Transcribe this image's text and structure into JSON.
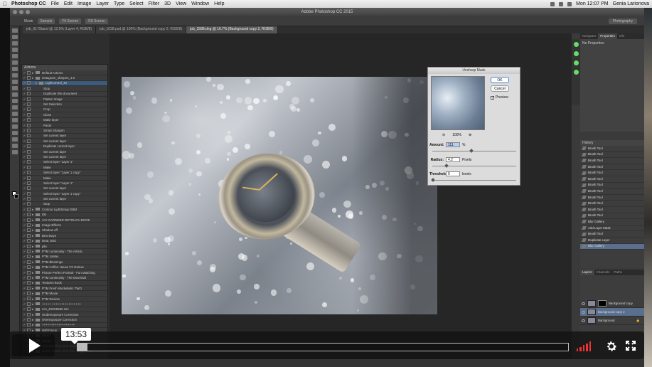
{
  "menubar": {
    "app_name": "Photoshop CC",
    "items": [
      "File",
      "Edit",
      "Image",
      "Layer",
      "Type",
      "Select",
      "Filter",
      "3D",
      "View",
      "Window",
      "Help"
    ],
    "clock": "Mon 12:07 PM",
    "user": "Genia Larionova"
  },
  "titlebar": {
    "title": "Adobe Photoshop CC 2015"
  },
  "optionsbar": {
    "mode_label": "Mode",
    "btn1": "Sample",
    "btn2": "Fit Screen",
    "btn3": "Fill Screen",
    "workspace": "Photography"
  },
  "tabs": [
    "job_917Stand @ 12.5% (Layer 4, RGB/8)",
    "job_1038.psd @ 100% (Background copy 2, RGB/8)",
    "job_1588.dng @ 16.7% (Background copy 2, RGB/8)"
  ],
  "actions_panel": {
    "title": "Actions",
    "rows": [
      {
        "label": "Default Actions",
        "lvl": 0
      },
      {
        "label": "instagram_sharpen_3.0",
        "lvl": 0
      },
      {
        "label": "Lightcontrol_40",
        "lvl": 1
      },
      {
        "label": "Stop",
        "lvl": 2
      },
      {
        "label": "Duplicate first document",
        "lvl": 2
      },
      {
        "label": "Flatten Image",
        "lvl": 2
      },
      {
        "label": "Set Selection",
        "lvl": 2
      },
      {
        "label": "Crop",
        "lvl": 2
      },
      {
        "label": "Close",
        "lvl": 2
      },
      {
        "label": "Make layer",
        "lvl": 2
      },
      {
        "label": "Paste",
        "lvl": 2
      },
      {
        "label": "Smart Sharpen",
        "lvl": 2
      },
      {
        "label": "Set current layer",
        "lvl": 2
      },
      {
        "label": "Set current layer",
        "lvl": 2
      },
      {
        "label": "Duplicate current layer",
        "lvl": 2
      },
      {
        "label": "Set current layer",
        "lvl": 2
      },
      {
        "label": "Set current layer",
        "lvl": 2
      },
      {
        "label": "Select layer \"Layer 1\"",
        "lvl": 2
      },
      {
        "label": "Make",
        "lvl": 2
      },
      {
        "label": "Select layer \"Layer 1 copy\"",
        "lvl": 2
      },
      {
        "label": "Make",
        "lvl": 2
      },
      {
        "label": "Select layer \"Layer 1\"",
        "lvl": 2
      },
      {
        "label": "Set current layer",
        "lvl": 2
      },
      {
        "label": "Select layer \"Layer 1 copy\"",
        "lvl": 2
      },
      {
        "label": "Set current layer",
        "lvl": 2
      },
      {
        "label": "Stop",
        "lvl": 2
      },
      {
        "label": "Contour LightSetup GBM",
        "lvl": 0
      },
      {
        "label": "DB",
        "lvl": 0
      },
      {
        "label": "JAY GARNDER RETOUCH BOOK",
        "lvl": 0
      },
      {
        "label": "Image Effects",
        "lvl": 0
      },
      {
        "label": "Shadow off",
        "lvl": 0
      },
      {
        "label": "Best Days",
        "lvl": 0
      },
      {
        "label": "Dear, Bird",
        "lvl": 0
      },
      {
        "label": "pilo",
        "lvl": 0
      },
      {
        "label": "PTM Luminosity - The Artistic",
        "lvl": 0
      },
      {
        "label": "PTM JoMax",
        "lvl": 0
      },
      {
        "label": "PTM Blessings",
        "lvl": 0
      },
      {
        "label": "PTM Coffee House FX Deluxe",
        "lvl": 0
      },
      {
        "label": "Picture Perfect Portrait - Fun Matching",
        "lvl": 0
      },
      {
        "label": "PTM Luminosity - The Essential",
        "lvl": 0
      },
      {
        "label": "Textures Book",
        "lvl": 0
      },
      {
        "label": "PTM Fresh Workaholic TWO",
        "lvl": 0
      },
      {
        "label": "PTM Movie",
        "lvl": 0
      },
      {
        "label": "PTM Review",
        "lvl": 0
      },
      {
        "label": "+++++ ++++++++++++++++",
        "lvl": 0
      },
      {
        "label": "ece_DWS5686 mix",
        "lvl": 0
      },
      {
        "label": "Underexposure Correction",
        "lvl": 0
      },
      {
        "label": "Overexposure Correction",
        "lvl": 0
      },
      {
        "label": "++++++++++++++++++",
        "lvl": 0
      },
      {
        "label": "Soft Focus",
        "lvl": 0
      },
      {
        "label": "Mixed",
        "lvl": 0
      },
      {
        "label": "Clarity",
        "lvl": 0
      },
      {
        "label": "Contrast All In One Mega Base",
        "lvl": 0
      },
      {
        "label": "Desert Beach All In One Mega Base",
        "lvl": 0
      }
    ]
  },
  "dialog": {
    "title": "Unsharp Mask",
    "ok": "OK",
    "cancel": "Cancel",
    "preview_label": "Preview",
    "zoom": "100%",
    "amount_label": "Amount:",
    "amount_value": "111",
    "amount_unit": "%",
    "radius_label": "Radius:",
    "radius_value": "4.2",
    "radius_unit": "Pixels",
    "threshold_label": "Threshold:",
    "threshold_value": "0",
    "threshold_unit": "levels"
  },
  "right_panel": {
    "tabs": [
      "Navigator",
      "Properties",
      "Info"
    ],
    "properties_text": "No Properties",
    "history_title": "History",
    "history": [
      "Brush Tool",
      "Brush Tool",
      "Brush Tool",
      "Brush Tool",
      "Brush Tool",
      "Brush Tool",
      "Brush Tool",
      "Brush Tool",
      "Brush Tool",
      "Brush Tool",
      "Brush Tool",
      "Brush Tool",
      "Blur Gallery",
      "Add Layer Mask",
      "Brush Tool",
      "Duplicate Layer",
      "Blur Gallery"
    ],
    "layers_tabs": [
      "Layers",
      "Channels",
      "Paths"
    ],
    "layers": [
      "Background copy",
      "Background copy 2",
      "Background"
    ]
  },
  "player": {
    "timecode": "13:53",
    "progress": 0.02,
    "volume_bars": 5
  },
  "colors": {
    "accent": "#3c5a7a",
    "volume": "#ee3333"
  }
}
